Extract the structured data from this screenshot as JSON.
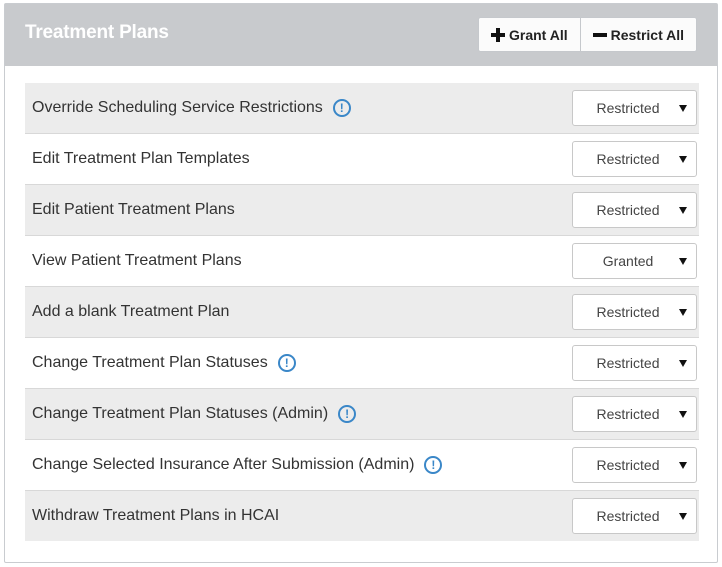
{
  "header": {
    "title": "Treatment Plans",
    "grant_all_label": "Grant All",
    "restrict_all_label": "Restrict All"
  },
  "permissions": [
    {
      "label": "Override Scheduling Service Restrictions",
      "info": true,
      "value": "Restricted"
    },
    {
      "label": "Edit Treatment Plan Templates",
      "info": false,
      "value": "Restricted"
    },
    {
      "label": "Edit Patient Treatment Plans",
      "info": false,
      "value": "Restricted"
    },
    {
      "label": "View Patient Treatment Plans",
      "info": false,
      "value": "Granted"
    },
    {
      "label": "Add a blank Treatment Plan",
      "info": false,
      "value": "Restricted"
    },
    {
      "label": "Change Treatment Plan Statuses",
      "info": true,
      "value": "Restricted"
    },
    {
      "label": "Change Treatment Plan Statuses (Admin)",
      "info": true,
      "value": "Restricted"
    },
    {
      "label": "Change Selected Insurance After Submission (Admin)",
      "info": true,
      "value": "Restricted"
    },
    {
      "label": "Withdraw Treatment Plans in HCAI",
      "info": false,
      "value": "Restricted"
    }
  ],
  "colors": {
    "header_bg": "#c8cacd",
    "info_icon": "#3a87c8",
    "alt_row_bg": "#ececec"
  },
  "icons": {
    "grant": "plus-icon",
    "restrict": "minus-icon",
    "info": "info-icon",
    "dropdown": "chevron-down-icon"
  }
}
